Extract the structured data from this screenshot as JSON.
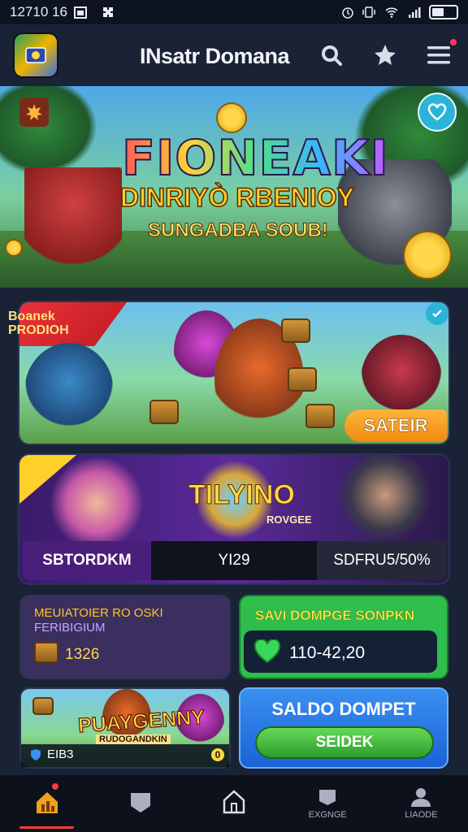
{
  "status_bar": {
    "time": "12710 16",
    "icons": [
      "calendar-icon",
      "puzzle-icon",
      "alarm-icon",
      "vibrate-icon",
      "wifi-icon",
      "signal-icon",
      "battery-icon"
    ]
  },
  "app_bar": {
    "title": "INsatr Domana",
    "icons": [
      "search-icon",
      "star-icon",
      "menu-icon"
    ]
  },
  "hero": {
    "title": "FIONEAKI",
    "subtitle": "DINRIYÒ RBENIOY",
    "tagline": "SUNGADBA SOUB!"
  },
  "promo_card": {
    "ribbon": "Boanek PRODIOH",
    "button": "SATEIR"
  },
  "event_card": {
    "title": "TILYINO",
    "subtitle": "ROVGEE",
    "bar": [
      "SBTORDKM",
      "YI29",
      "SDFRU5/50%"
    ]
  },
  "stats_card": {
    "title_line1": "MEUIATOIER RO OSKI",
    "title_line2": "FERIBIGIUM",
    "value": "1326"
  },
  "wallet_small": {
    "title": "SAVI DOMPGE SONPKN",
    "value": "110-42,20"
  },
  "game_card": {
    "title": "PUAYGENNY",
    "subtitle": "RUDOGANDKIN",
    "left": "EIB3",
    "right": "0"
  },
  "wallet_card": {
    "title": "SALDO DOMPET",
    "button": "SEIDEK"
  },
  "bottom_nav": {
    "items": [
      {
        "label": "",
        "icon": "home-chart-icon",
        "active": true
      },
      {
        "label": "",
        "icon": "shield-icon",
        "active": false
      },
      {
        "label": "",
        "icon": "house-icon",
        "active": false
      },
      {
        "label": "EXGNGE",
        "icon": "exchange-icon",
        "active": false
      },
      {
        "label": "LIAODE",
        "icon": "profile-icon",
        "active": false
      }
    ]
  },
  "colors": {
    "background": "#141a2b",
    "accent": "#ff3b3b",
    "gold": "#ffd84a",
    "green": "#2fbd4e",
    "blue": "#1a62d8"
  }
}
